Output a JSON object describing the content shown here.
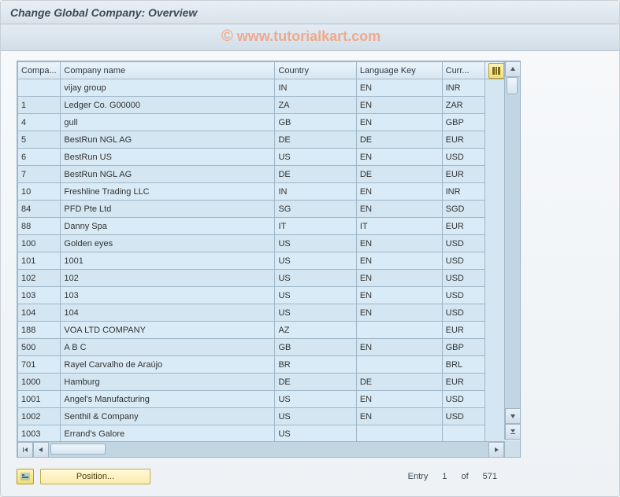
{
  "title": "Change Global Company: Overview",
  "watermark": "www.tutorialkart.com",
  "columns": {
    "company": "Compa...",
    "company_name": "Company name",
    "country": "Country",
    "language_key": "Language Key",
    "currency": "Curr..."
  },
  "rows": [
    {
      "company": "",
      "name": "vijay group",
      "country": "IN",
      "lang": "EN",
      "curr": "INR"
    },
    {
      "company": "1",
      "name": "Ledger Co. G00000",
      "country": "ZA",
      "lang": "EN",
      "curr": "ZAR"
    },
    {
      "company": "4",
      "name": "gull",
      "country": "GB",
      "lang": "EN",
      "curr": "GBP"
    },
    {
      "company": "5",
      "name": "BestRun NGL AG",
      "country": "DE",
      "lang": "DE",
      "curr": "EUR"
    },
    {
      "company": "6",
      "name": "BestRun US",
      "country": "US",
      "lang": "EN",
      "curr": "USD"
    },
    {
      "company": "7",
      "name": "BestRun NGL AG",
      "country": "DE",
      "lang": "DE",
      "curr": "EUR"
    },
    {
      "company": "10",
      "name": "Freshline Trading LLC",
      "country": "IN",
      "lang": "EN",
      "curr": "INR"
    },
    {
      "company": "84",
      "name": "PFD Pte Ltd",
      "country": "SG",
      "lang": "EN",
      "curr": "SGD"
    },
    {
      "company": "88",
      "name": "Danny Spa",
      "country": "IT",
      "lang": "IT",
      "curr": "EUR"
    },
    {
      "company": "100",
      "name": "Golden eyes",
      "country": "US",
      "lang": "EN",
      "curr": "USD"
    },
    {
      "company": "101",
      "name": "1001",
      "country": "US",
      "lang": "EN",
      "curr": "USD"
    },
    {
      "company": "102",
      "name": "102",
      "country": "US",
      "lang": "EN",
      "curr": "USD"
    },
    {
      "company": "103",
      "name": "103",
      "country": "US",
      "lang": "EN",
      "curr": "USD"
    },
    {
      "company": "104",
      "name": "104",
      "country": "US",
      "lang": "EN",
      "curr": "USD"
    },
    {
      "company": "188",
      "name": "VOA LTD COMPANY",
      "country": "AZ",
      "lang": "",
      "curr": "EUR"
    },
    {
      "company": "500",
      "name": "A B C",
      "country": "GB",
      "lang": "EN",
      "curr": "GBP"
    },
    {
      "company": "701",
      "name": "Rayel Carvalho de Araújo",
      "country": "BR",
      "lang": "",
      "curr": "BRL"
    },
    {
      "company": "1000",
      "name": "Hamburg",
      "country": "DE",
      "lang": "DE",
      "curr": "EUR"
    },
    {
      "company": "1001",
      "name": "Angel's Manufacturing",
      "country": "US",
      "lang": "EN",
      "curr": "USD"
    },
    {
      "company": "1002",
      "name": "Senthil & Company",
      "country": "US",
      "lang": "EN",
      "curr": "USD"
    },
    {
      "company": "1003",
      "name": "Errand's Galore",
      "country": "US",
      "lang": "",
      "curr": ""
    }
  ],
  "footer": {
    "position_label": "Position...",
    "entry_label": "Entry",
    "entry_from": "1",
    "entry_of_label": "of",
    "entry_total": "571"
  }
}
